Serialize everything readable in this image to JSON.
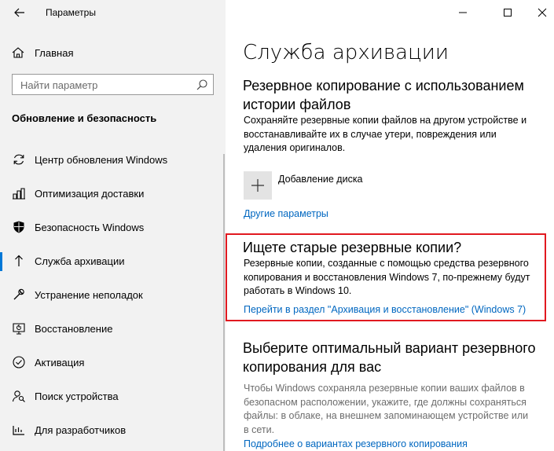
{
  "window": {
    "title": "Параметры"
  },
  "sidebar": {
    "home_label": "Главная",
    "search_placeholder": "Найти параметр",
    "section_title": "Обновление и безопасность",
    "items": [
      {
        "label": "Центр обновления Windows",
        "icon": "sync-icon",
        "selected": false
      },
      {
        "label": "Оптимизация доставки",
        "icon": "delivery-icon",
        "selected": false
      },
      {
        "label": "Безопасность Windows",
        "icon": "shield-icon",
        "selected": false
      },
      {
        "label": "Служба архивации",
        "icon": "backup-arrow-icon",
        "selected": true
      },
      {
        "label": "Устранение неполадок",
        "icon": "wrench-icon",
        "selected": false
      },
      {
        "label": "Восстановление",
        "icon": "recovery-icon",
        "selected": false
      },
      {
        "label": "Активация",
        "icon": "check-circle-icon",
        "selected": false
      },
      {
        "label": "Поиск устройства",
        "icon": "person-search-icon",
        "selected": false
      },
      {
        "label": "Для разработчиков",
        "icon": "developer-icon",
        "selected": false
      }
    ]
  },
  "main": {
    "title": "Служба архивации",
    "file_history": {
      "heading": "Резервное копирование с использованием истории файлов",
      "description": "Сохраняйте резервные копии файлов на другом устройстве и восстанавливайте их в случае утери, повреждения или удаления оригиналов.",
      "add_drive_label": "Добавление диска",
      "more_options_link": "Другие параметры"
    },
    "old_backup": {
      "heading": "Ищете старые резервные копии?",
      "description": "Резервные копии, созданные с помощью средства резервного копирования и восстановления Windows 7, по-прежнему будут работать в Windows 10.",
      "link": "Перейти в раздел \"Архивация и восстановление\" (Windows 7)"
    },
    "choose": {
      "heading": "Выберите оптимальный вариант резервного копирования для вас",
      "description": "Чтобы Windows сохраняла резервные копии ваших файлов в безопасном расположении, укажите, где должны сохраняться файлы: в облаке, на внешнем запоминающем устройстве или в сети.",
      "link": "Подробнее о вариантах резервного копирования"
    }
  },
  "colors": {
    "accent": "#0078d7",
    "link": "#0067c0",
    "highlight_box": "#e11920"
  }
}
